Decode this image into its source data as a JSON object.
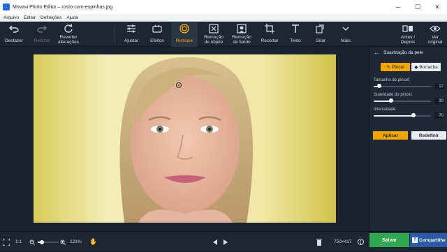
{
  "window": {
    "title": "Movavi Photo Editor – rosto-com-espinhas.jpg"
  },
  "menu": [
    "Arquivo",
    "Editar",
    "Definições",
    "Ajuda"
  ],
  "toolbar": {
    "undo": "Desfazer",
    "redo": "Refazer",
    "revert": [
      "Reverter",
      "alterações"
    ],
    "adjust": "Ajustar",
    "effects": "Efeitos",
    "retouch": "Retoque",
    "object_removal": [
      "Remoção",
      "de objeto"
    ],
    "bg_removal": [
      "Remoção",
      "de fundo"
    ],
    "crop": "Recortar",
    "text": "Texto",
    "rotate": "Girar",
    "more": "Mais",
    "before_after": [
      "Antes /",
      "Depois"
    ],
    "view_original": [
      "Ver",
      "original"
    ]
  },
  "panel": {
    "title": "Suavização da pele",
    "brush_tab": "Pincel",
    "eraser_tab": "Borracha",
    "sliders": [
      {
        "label": "Tamanho do pincel:",
        "value": "17",
        "fraction": 0.1
      },
      {
        "label": "Suavidade do pincel:",
        "value": "30",
        "fraction": 0.3
      },
      {
        "label": "Intensidade:",
        "value": "70",
        "fraction": 0.7
      }
    ],
    "apply": "Aplicar",
    "reset": "Redefinir"
  },
  "status": {
    "fit": "1:1",
    "zoom": "121%",
    "zoom_fraction": 0.2,
    "dimensions": "750×417",
    "save": "Salvar",
    "share": "Compartilhe"
  },
  "colors": {
    "accent": "#f0a500",
    "save": "#2fa84f",
    "share": "#2d5aa6",
    "toolbar": "#1d2734"
  }
}
